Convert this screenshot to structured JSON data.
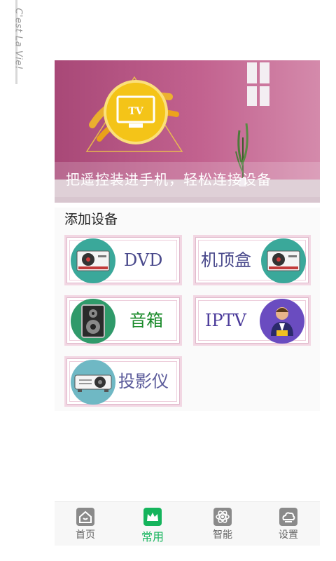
{
  "side_caption": "C'est La Vie!",
  "banner": {
    "badge_text": "TV",
    "caption": "把遥控装进手机，轻松连接设备"
  },
  "section": {
    "title": "添加设备"
  },
  "devices": [
    {
      "label": "DVD",
      "icon": "dvd-player-icon"
    },
    {
      "label": "机顶盒",
      "icon": "set-top-box-icon"
    },
    {
      "label": "音箱",
      "icon": "speaker-icon"
    },
    {
      "label": "IPTV",
      "icon": "presenter-icon"
    },
    {
      "label": "投影仪",
      "icon": "projector-icon"
    }
  ],
  "nav": [
    {
      "label": "首页",
      "icon": "home-icon"
    },
    {
      "label": "常用",
      "icon": "crown-icon",
      "active": true
    },
    {
      "label": "智能",
      "icon": "atom-icon"
    },
    {
      "label": "设置",
      "icon": "settings-cloud-icon"
    }
  ],
  "colors": {
    "teal": "#3aa89a",
    "dvd_text": "#4a4a8c",
    "speaker_text": "#1a8a2a",
    "iptv_text": "#4a3a9a",
    "projector_text": "#5a5a9a",
    "active_nav": "#15b45c"
  }
}
